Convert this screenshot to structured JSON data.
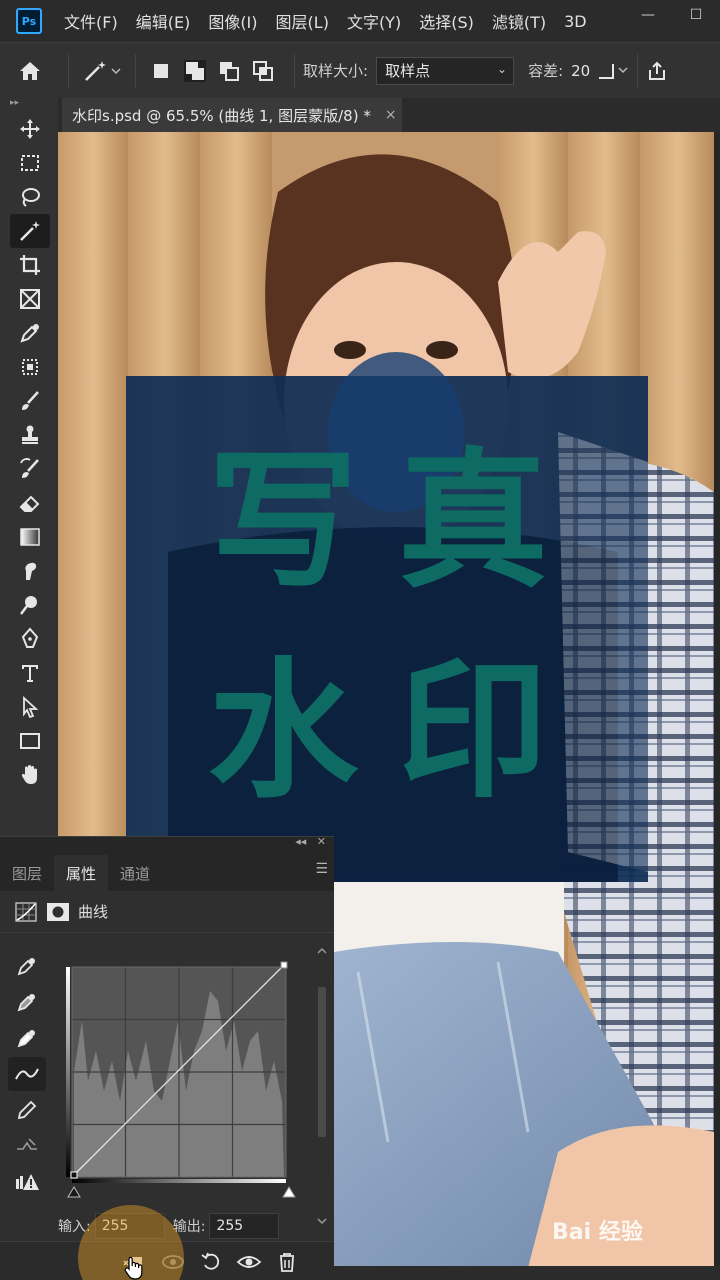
{
  "app": {
    "logo": "Ps"
  },
  "menu": {
    "items": [
      "文件(F)",
      "编辑(E)",
      "图像(I)",
      "图层(L)",
      "文字(Y)",
      "选择(S)",
      "滤镜(T)",
      "3D"
    ]
  },
  "window_controls": {
    "minimize": "—",
    "restore": "☐"
  },
  "options_bar": {
    "sample_size_label": "取样大小:",
    "sample_size_value": "取样点",
    "tolerance_label": "容差:",
    "tolerance_value": "20"
  },
  "document": {
    "tab_title": "水印s.psd @ 65.5% (曲线 1, 图层蒙版/8) *",
    "close_glyph": "×"
  },
  "watermark": {
    "line1": "写真",
    "line2": "水印"
  },
  "brand_watermark": "Bai 经验",
  "panel": {
    "tabs": [
      "图层",
      "属性",
      "通道"
    ],
    "active_tab": 1,
    "title": "曲线",
    "input_label": "输入:",
    "input_value": "255",
    "output_label": "输出:",
    "output_value": "255",
    "collapse_glyph": "◂◂",
    "close_glyph": "✕"
  },
  "colors": {
    "accent": "#31a8ff",
    "overlay_blue": "#0f2d54",
    "watermark_teal": "#0d6b63",
    "highlight": "#e6a028"
  }
}
